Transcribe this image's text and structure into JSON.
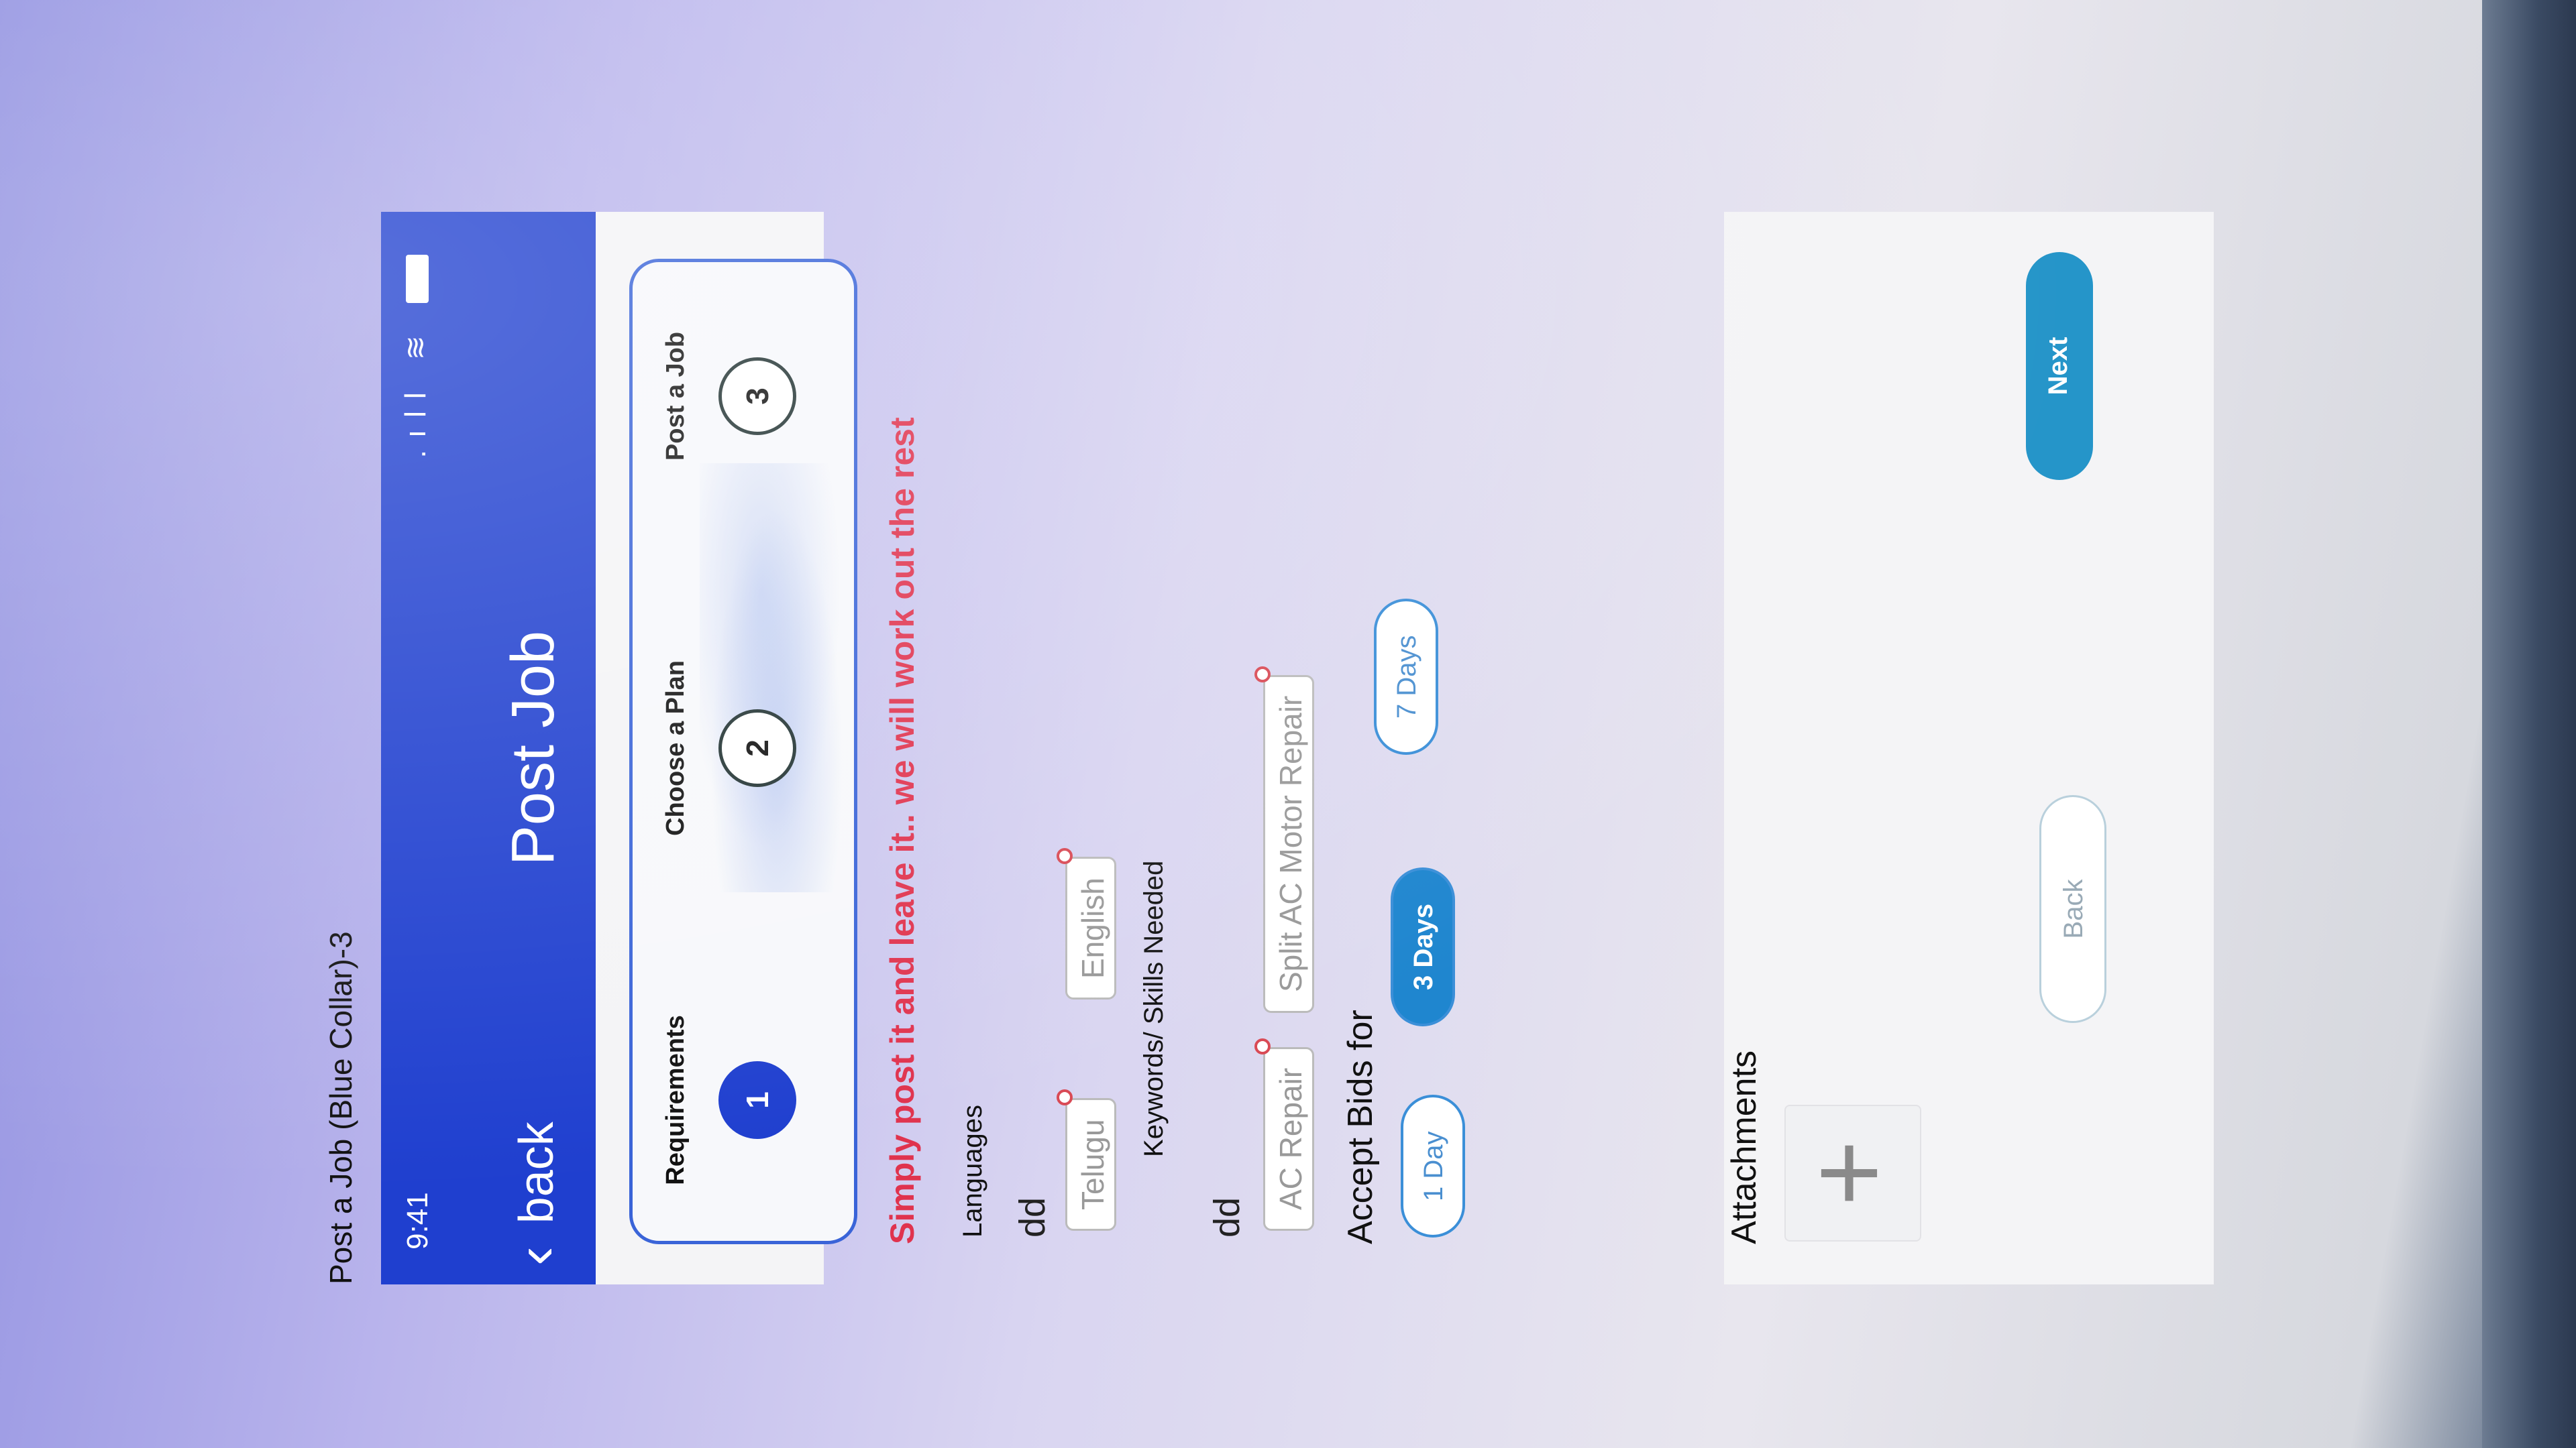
{
  "frame_title": "Post a Job  (Blue Collar)-3",
  "status_bar": {
    "time": "9:41",
    "signal_glyph": ".ıll",
    "wifi_glyph": "≋"
  },
  "nav": {
    "back_label": "back",
    "title": "Post Job",
    "chevron_glyph": "‹"
  },
  "stepper": {
    "steps": [
      {
        "number": "1",
        "label": "Requirements",
        "active": true
      },
      {
        "number": "2",
        "label": "Choose a Plan",
        "active": false
      },
      {
        "number": "3",
        "label": "Post a Job",
        "active": false
      }
    ]
  },
  "tagline": "Simply post it and leave it.. we will work out the rest",
  "languages": {
    "label": "Languages",
    "value": "dd",
    "chips": [
      "Telugu",
      "English"
    ]
  },
  "keywords": {
    "label": "Keywords/ Skills Needed",
    "value": "dd",
    "chips": [
      "AC Repair",
      "Split AC Motor Repair"
    ]
  },
  "accept_bids": {
    "label": "Accept Bids for",
    "options": [
      "1 Day",
      "3 Days",
      "7 Days"
    ],
    "selected": "3 Days"
  },
  "attachments": {
    "label": "Attachments",
    "add_glyph": "+"
  },
  "buttons": {
    "back": "Back",
    "next": "Next"
  },
  "colors": {
    "primary": "#1f3fcf",
    "accent": "#2595c9",
    "tagline": "#e0334e"
  }
}
